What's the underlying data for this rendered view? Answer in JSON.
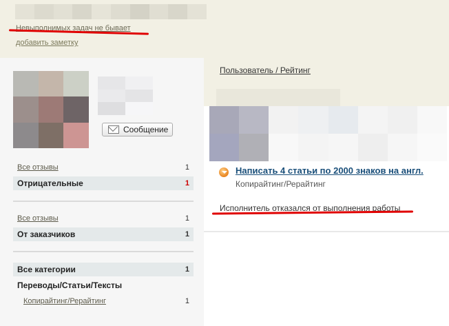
{
  "header": {
    "status_text": "Невыполнимых задач не бывает",
    "add_note": "добавить заметку",
    "name_blur_colors": [
      "#e4e2d6",
      "#dcdace",
      "#e2e0d4",
      "#d8d6ca",
      "#e6e4d8",
      "#dedcd0",
      "#d4d2c6",
      "#e0ded2",
      "#d8d6ca",
      "#e4e2d6"
    ]
  },
  "profile": {
    "avatar_colors": [
      "#b9b9b4",
      "#c4b6aa",
      "#ccd0c6",
      "#9c8f8c",
      "#9d7a76",
      "#6e6466",
      "#8d8a8c",
      "#7e6f66",
      "#cd9593"
    ],
    "thumb_colors": [
      "#e6e6e8",
      "#f0f0f2",
      "#eaeaec",
      "#e4e4e6",
      "#dedee0",
      "#f6f6f8"
    ],
    "message_button": "Сообщение"
  },
  "sidebar": {
    "group1": [
      {
        "label": "Все отзывы",
        "count": "1"
      },
      {
        "label": "Отрицательные",
        "count": "1",
        "count_color": "#cc0000"
      }
    ],
    "group2": [
      {
        "label": "Все отзывы",
        "count": "1"
      },
      {
        "label": "От заказчиков",
        "count": "1"
      }
    ],
    "group3": [
      {
        "label": "Все категории",
        "count": "1"
      },
      {
        "label": "Переводы/Статьи/Тексты",
        "count": ""
      },
      {
        "label": "Копирайтинг/Рерайтинг",
        "count": "1"
      }
    ]
  },
  "main": {
    "breadcrumb": "Пользователь / Рейтинг",
    "blur_colors": [
      "#a8a8b8",
      "#b8b8c4",
      "#f2f2f2",
      "#eef0f2",
      "#e6eaee",
      "#f4f4f4",
      "#f0f0f0",
      "#f8f8f8",
      "#a4a6be",
      "#b0b0b6",
      "#f8f8f8",
      "#f4f4f4",
      "#f6f6f6",
      "#eeeeee",
      "#f6f6f6",
      "#fafafa"
    ],
    "order_title": "Написать 4 статьи по 2000 знаков на англ.",
    "order_category": "Копирайтинг/Рерайтинг",
    "refusal": "Исполнитель отказался от выполнения работы"
  },
  "colors": {
    "annotation_red": "#e00000",
    "link_blue": "#1a4f7a"
  }
}
